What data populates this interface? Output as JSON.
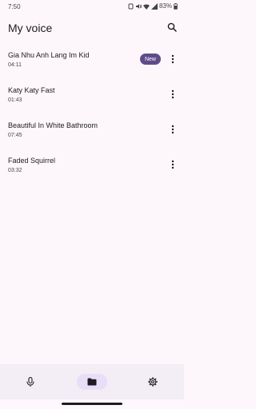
{
  "status_bar": {
    "time": "7:50",
    "battery": "83%"
  },
  "header": {
    "title": "My voice"
  },
  "recordings": [
    {
      "title": "Gia Nhu Anh Lang Im Kid",
      "duration": "04:11",
      "badge": "New"
    },
    {
      "title": "Katy Katy Fast",
      "duration": "01:43"
    },
    {
      "title": "Beautiful In White Bathroom",
      "duration": "07:45"
    },
    {
      "title": "Faded Squirrel",
      "duration": "03:32"
    }
  ],
  "nav": {
    "active": "files"
  },
  "colors": {
    "accent": "#5f4b8b",
    "background": "#fdf7fc",
    "nav_background": "#f3edf6",
    "active_pill": "#e8def8"
  }
}
